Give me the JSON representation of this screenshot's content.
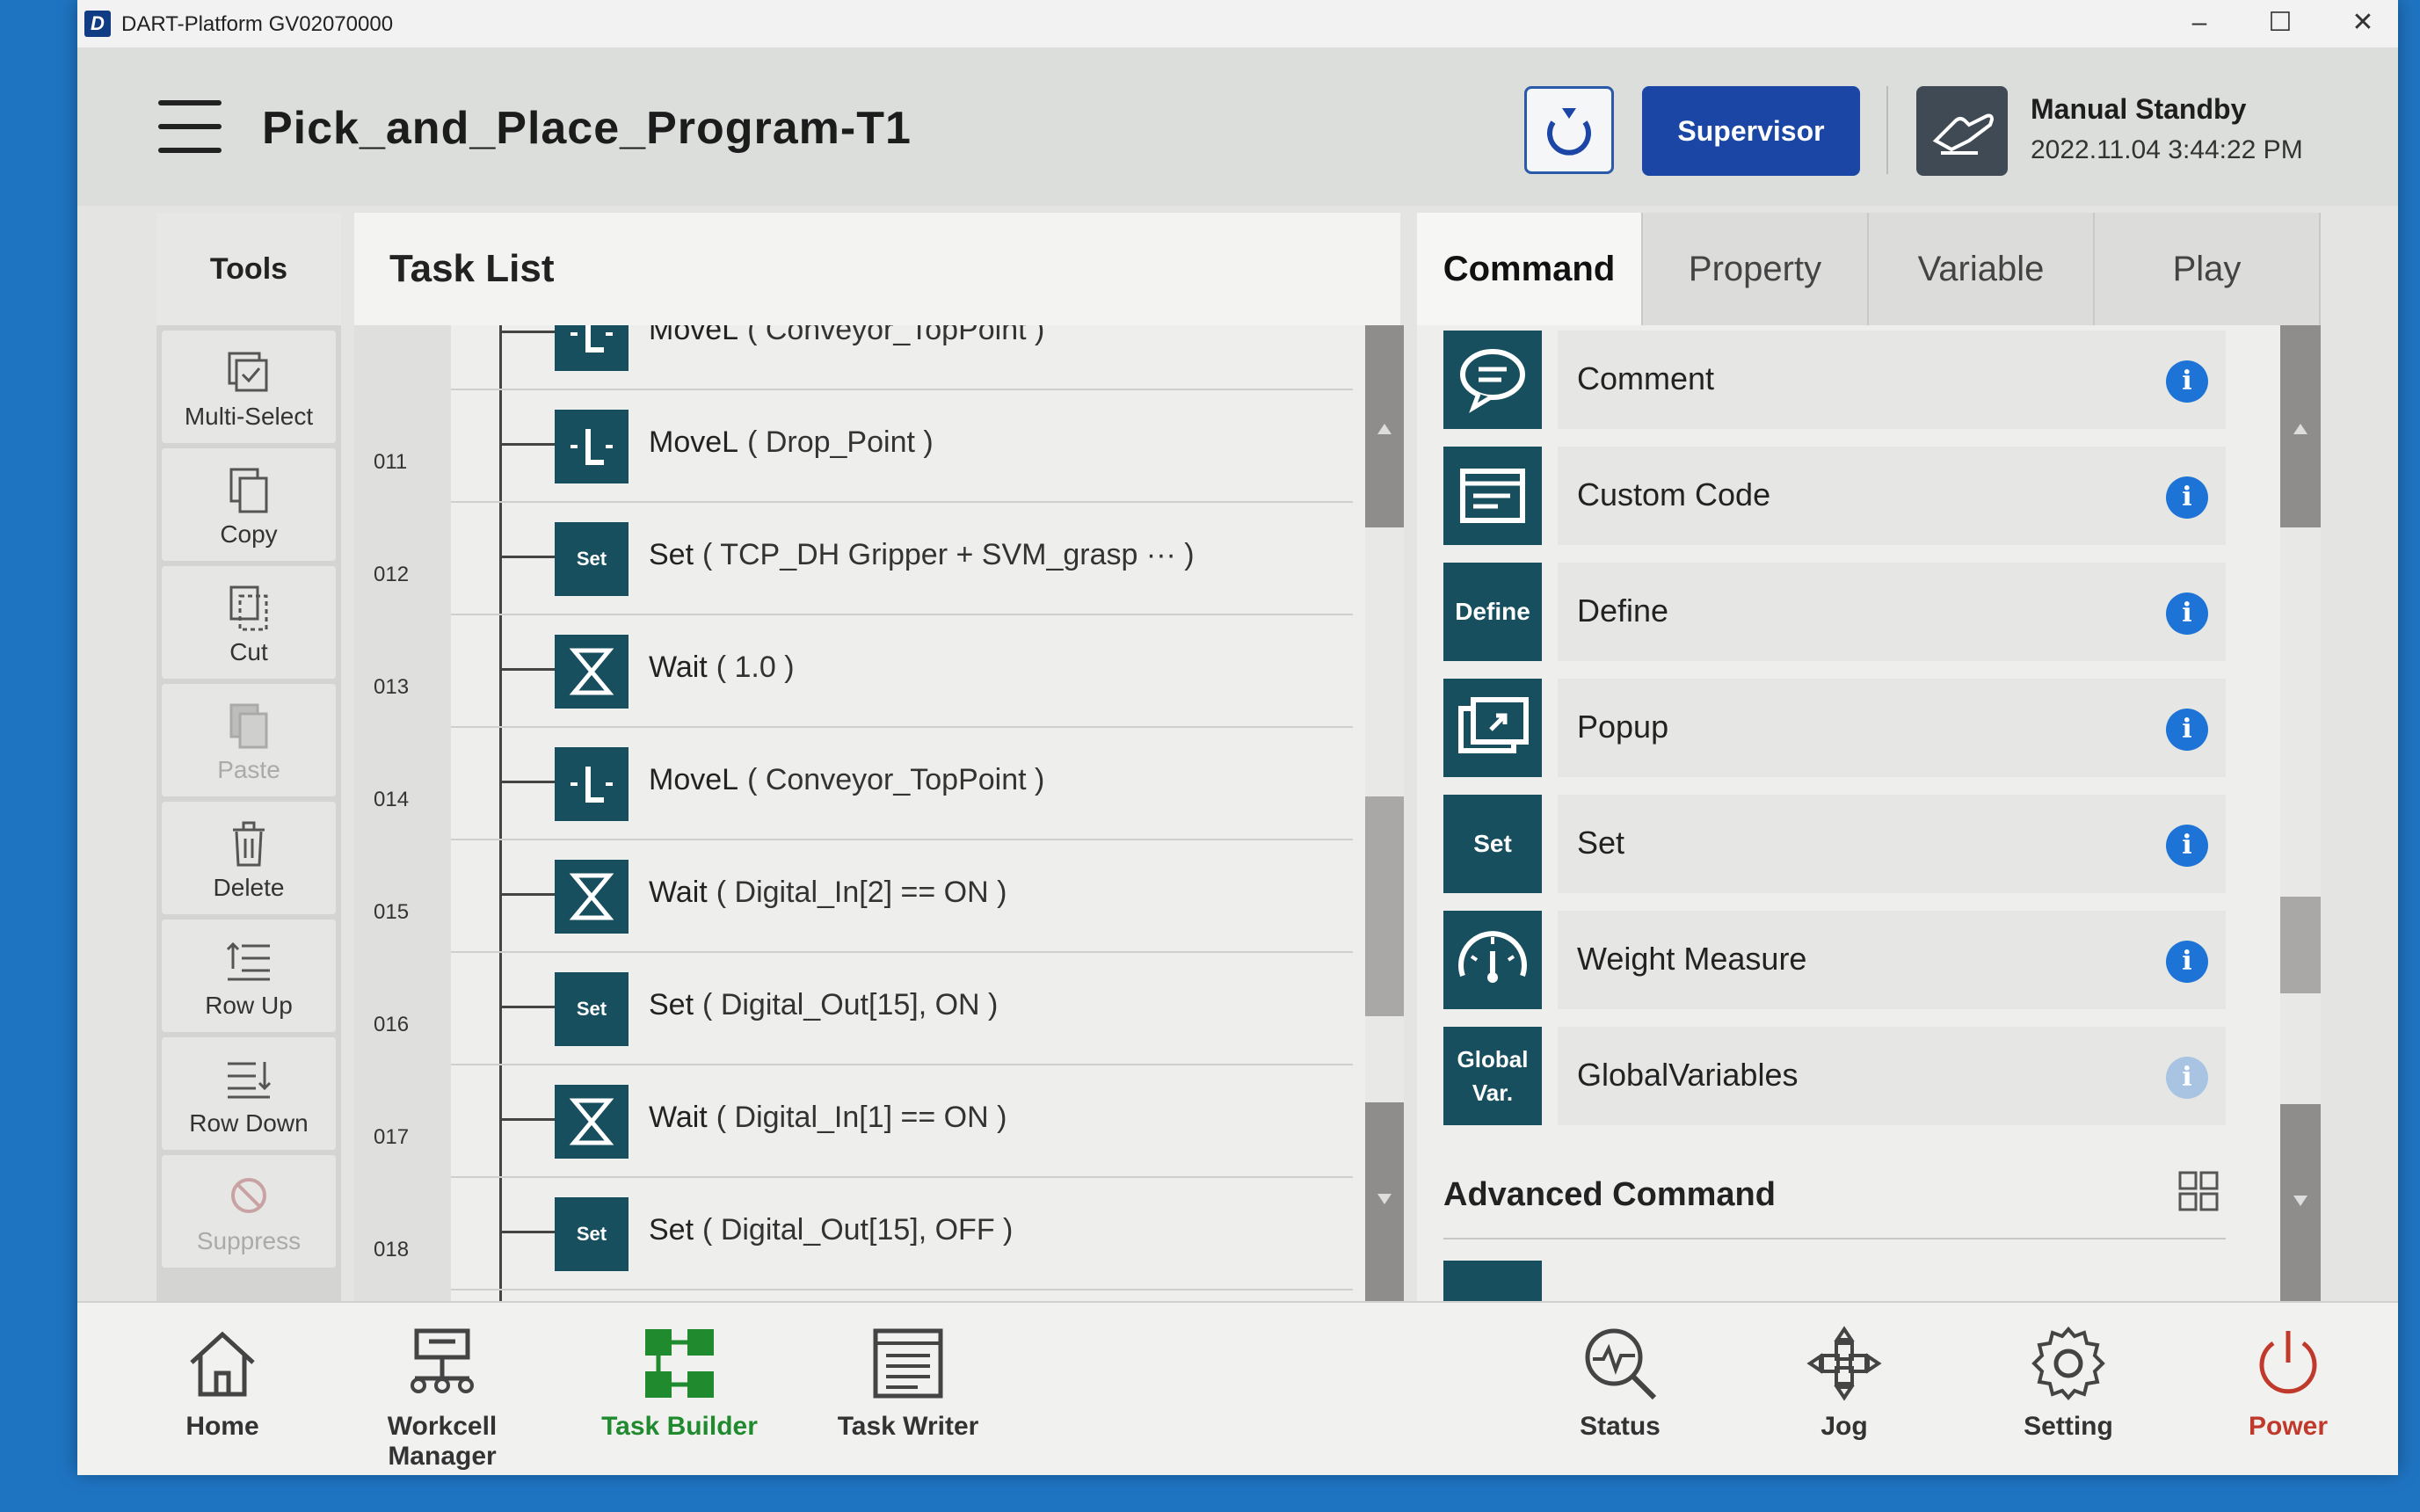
{
  "window": {
    "title": "DART-Platform GV02070000"
  },
  "header": {
    "program_title": "Pick_and_Place_Program-T1",
    "supervisor_label": "Supervisor",
    "mode_title": "Manual Standby",
    "mode_time": "2022.11.04 3:44:22 PM"
  },
  "tools": {
    "title": "Tools",
    "items": [
      {
        "label": "Multi-Select",
        "enabled": true
      },
      {
        "label": "Copy",
        "enabled": true
      },
      {
        "label": "Cut",
        "enabled": true
      },
      {
        "label": "Paste",
        "enabled": false
      },
      {
        "label": "Delete",
        "enabled": true
      },
      {
        "label": "Row Up",
        "enabled": true
      },
      {
        "label": "Row Down",
        "enabled": true
      },
      {
        "label": "Suppress",
        "enabled": false
      }
    ]
  },
  "tasklist": {
    "title": "Task List",
    "rows": [
      {
        "num": "",
        "cmd": "MoveL",
        "args": "( Conveyor_TopPoint )",
        "icon": "movel-icon"
      },
      {
        "num": "011",
        "cmd": "MoveL",
        "args": "( Drop_Point )",
        "icon": "movel-icon"
      },
      {
        "num": "012",
        "cmd": "Set",
        "args": "( TCP_DH Gripper + SVM_grasp ··· )",
        "icon": "set-icon"
      },
      {
        "num": "013",
        "cmd": "Wait",
        "args": "( 1.0 )",
        "icon": "hourglass-icon"
      },
      {
        "num": "014",
        "cmd": "MoveL",
        "args": "( Conveyor_TopPoint )",
        "icon": "movel-icon"
      },
      {
        "num": "015",
        "cmd": "Wait",
        "args": "( Digital_In[2] == ON )",
        "icon": "hourglass-icon"
      },
      {
        "num": "016",
        "cmd": "Set",
        "args": "( Digital_Out[15], ON )",
        "icon": "set-icon"
      },
      {
        "num": "017",
        "cmd": "Wait",
        "args": "( Digital_In[1] == ON )",
        "icon": "hourglass-icon"
      },
      {
        "num": "018",
        "cmd": "Set",
        "args": "( Digital_Out[15], OFF )",
        "icon": "set-icon"
      }
    ],
    "set_icon_text": "Set"
  },
  "panel": {
    "tabs": [
      "Command",
      "Property",
      "Variable",
      "Play"
    ],
    "commands": [
      {
        "name": "Comment",
        "icon": "comment-icon"
      },
      {
        "name": "Custom Code",
        "icon": "custom-code-icon"
      },
      {
        "name": "Define",
        "icon": "define-icon",
        "icon_text": "Define"
      },
      {
        "name": "Popup",
        "icon": "popup-icon"
      },
      {
        "name": "Set",
        "icon": "set-icon",
        "icon_text": "Set"
      },
      {
        "name": "Weight Measure",
        "icon": "gauge-icon"
      },
      {
        "name": "GlobalVariables",
        "icon": "global-var-icon",
        "icon_text": "Global Var."
      }
    ],
    "advanced_title": "Advanced Command",
    "info_glyph": "i"
  },
  "bottom_nav": [
    {
      "label": "Home",
      "icon": "home-icon"
    },
    {
      "label": "Workcell Manager",
      "icon": "workcell-icon"
    },
    {
      "label": "Task Builder",
      "icon": "task-builder-icon",
      "active": true
    },
    {
      "label": "Task Writer",
      "icon": "task-writer-icon"
    },
    {
      "label": "Status",
      "icon": "status-icon"
    },
    {
      "label": "Jog",
      "icon": "jog-icon"
    },
    {
      "label": "Setting",
      "icon": "gear-icon"
    },
    {
      "label": "Power",
      "icon": "power-icon"
    }
  ],
  "colors": {
    "accent": "#1b46a6",
    "icon_bg": "#174f5e",
    "active_nav": "#1f8a2e",
    "power": "#c0392b",
    "info": "#1e74d6"
  }
}
